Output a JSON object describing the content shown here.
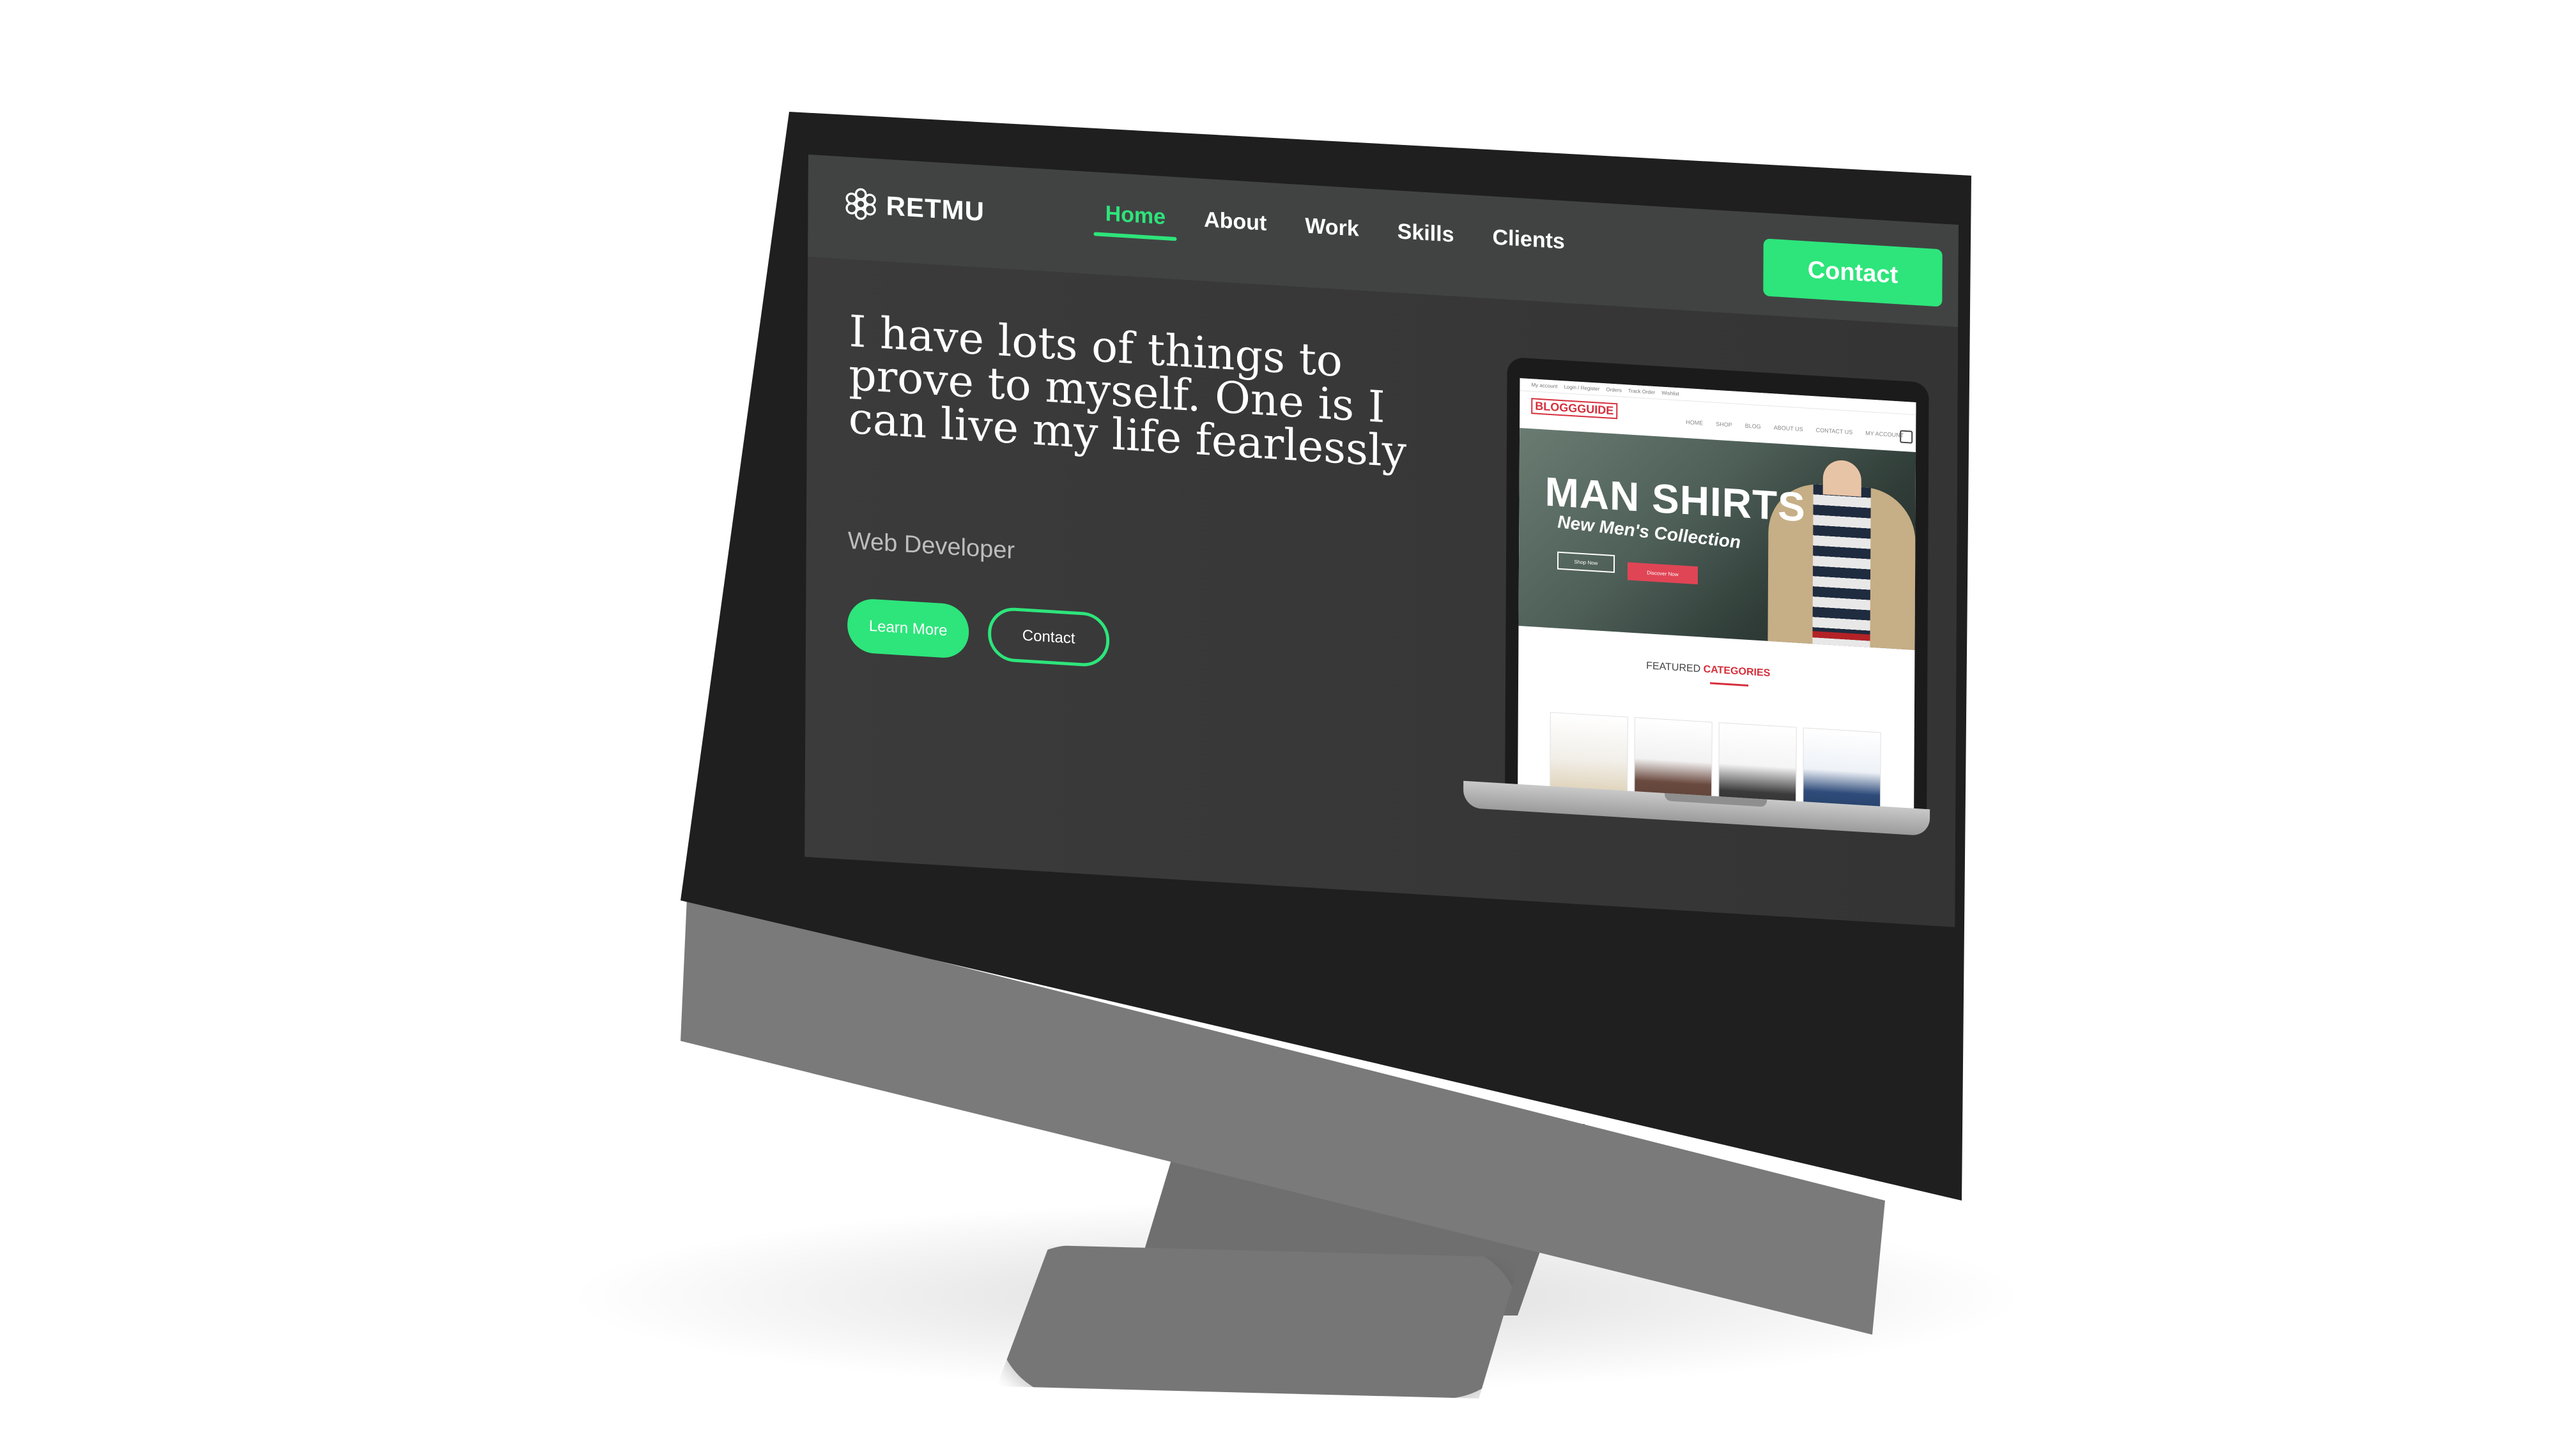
{
  "navbar": {
    "logo_text": "RETMU",
    "links": [
      {
        "label": "Home",
        "active": true
      },
      {
        "label": "About"
      },
      {
        "label": "Work"
      },
      {
        "label": "Skills"
      },
      {
        "label": "Clients"
      }
    ],
    "contact_label": "Contact"
  },
  "hero": {
    "headline": "I have lots of things to prove to myself. One is I can live my life fearlessly",
    "subtitle": "Web Developer",
    "buttons": {
      "learn_more": "Learn More",
      "contact": "Contact"
    }
  },
  "laptop_preview": {
    "brand": "BLOGGGUIDE",
    "top_links": [
      "My account",
      "Login / Register",
      "Orders",
      "Track Order",
      "Wishlist"
    ],
    "menu": [
      "HOME",
      "SHOP",
      "BLOG",
      "ABOUT US",
      "CONTACT US",
      "MY ACCOUNT"
    ],
    "hero_title": "MAN SHIRTS",
    "hero_subtitle": "New Men's Collection",
    "buttons": {
      "shop_now": "Shop Now",
      "discover_now": "Discover Now"
    },
    "featured_title": "FEATURED",
    "featured_highlight": "CATEGORIES"
  },
  "colors": {
    "accent": "#2de57b",
    "page_background": "#3a3a3a",
    "navbar_background": "#414343",
    "preview_brand": "#d62e3b"
  }
}
